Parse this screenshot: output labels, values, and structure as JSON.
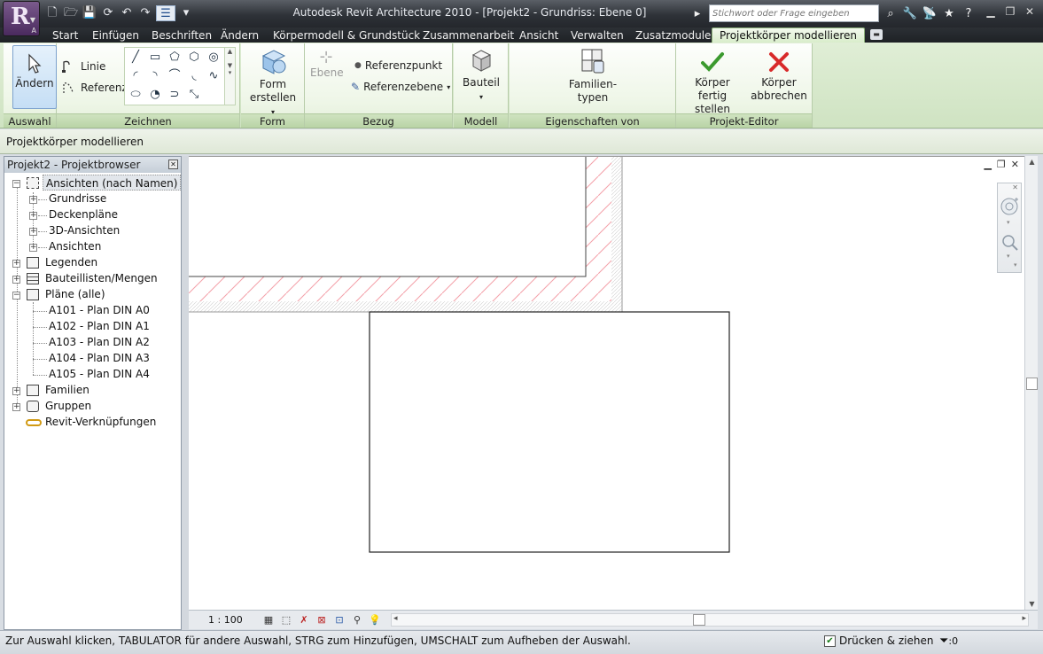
{
  "app": {
    "window_title": "Autodesk Revit Architecture 2010 - [Projekt2 - Grundriss: Ebene 0]",
    "logo_letter": "R",
    "logo_sub": "A"
  },
  "search": {
    "placeholder": "Stichwort oder Frage eingeben"
  },
  "ribbon_tabs": [
    {
      "label": "Start"
    },
    {
      "label": "Einfügen"
    },
    {
      "label": "Beschriften"
    },
    {
      "label": "Ändern"
    },
    {
      "label": "Körpermodell & Grundstück"
    },
    {
      "label": "Zusammenarbeit"
    },
    {
      "label": "Ansicht"
    },
    {
      "label": "Verwalten"
    },
    {
      "label": "Zusatzmodule"
    },
    {
      "label": "Projektkörper modellieren",
      "active": true
    }
  ],
  "panels": {
    "auswahl": {
      "label": "Auswahl",
      "modify": "Ändern"
    },
    "zeichnen": {
      "label": "Zeichnen",
      "line": "Linie",
      "reference": "Referenz"
    },
    "form": {
      "label": "Form",
      "create_form_1": "Form",
      "create_form_2": "erstellen"
    },
    "bezug": {
      "label": "Bezug",
      "level": "Ebene",
      "ref_point": "Referenzpunkt",
      "ref_plane": "Referenzebene"
    },
    "modell": {
      "label": "Modell",
      "component": "Bauteil"
    },
    "eigenschaften": {
      "label": "Eigenschaften von Projektelement",
      "family_types_1": "Familien-",
      "family_types_2": "typen"
    },
    "editor": {
      "label": "Projekt-Editor",
      "finish_1": "Körper",
      "finish_2": "fertig stellen",
      "cancel_1": "Körper",
      "cancel_2": "abbrechen"
    }
  },
  "options_bar": {
    "text": "Projektkörper modellieren"
  },
  "project_browser": {
    "title": "Projekt2 - Projektbrowser",
    "items": [
      {
        "label": "Ansichten (nach Namen)"
      },
      {
        "label": "Grundrisse"
      },
      {
        "label": "Deckenpläne"
      },
      {
        "label": "3D-Ansichten"
      },
      {
        "label": "Ansichten"
      },
      {
        "label": "Legenden"
      },
      {
        "label": "Bauteillisten/Mengen"
      },
      {
        "label": "Pläne (alle)"
      },
      {
        "label": "A101 - Plan DIN A0"
      },
      {
        "label": "A102 - Plan DIN A1"
      },
      {
        "label": "A103 - Plan DIN A2"
      },
      {
        "label": "A104 - Plan DIN A3"
      },
      {
        "label": "A105 - Plan DIN A4"
      },
      {
        "label": "Familien"
      },
      {
        "label": "Gruppen"
      },
      {
        "label": "Revit-Verknüpfungen"
      }
    ]
  },
  "view_bar": {
    "scale": "1 : 100"
  },
  "status_bar": {
    "text": "Zur Auswahl klicken, TABULATOR für andere Auswahl, STRG zum Hinzufügen, UMSCHALT zum Aufheben der Auswahl.",
    "drag_label": "Drücken & ziehen",
    "filter_count": ":0"
  },
  "colors": {
    "accent_green": "#d7ecc8",
    "hatch_red": "#f4a0a8"
  }
}
